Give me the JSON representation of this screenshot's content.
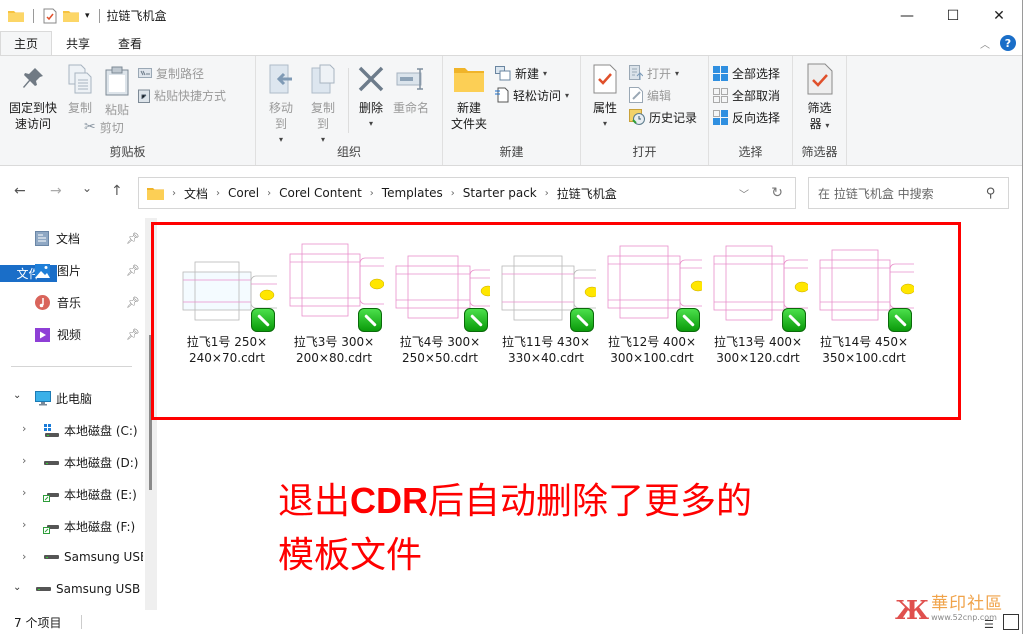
{
  "window": {
    "title": "拉链飞机盒",
    "controls": {
      "minimize": "—",
      "maximize": "☐",
      "close": "✕"
    }
  },
  "ribbon_tabs": [
    {
      "label": "文件"
    },
    {
      "label": "主页"
    },
    {
      "label": "共享"
    },
    {
      "label": "查看"
    }
  ],
  "ribbon": {
    "clipboard": {
      "label": "剪贴板",
      "pin": "固定到快\n速访问",
      "pin_l1": "固定到快",
      "pin_l2": "速访问",
      "copy": "复制",
      "paste": "粘贴",
      "copy_path": "复制路径",
      "paste_shortcut": "粘贴快捷方式",
      "cut": "剪切"
    },
    "organize": {
      "label": "组织",
      "move_to": "移动到",
      "copy_to": "复制到",
      "delete": "删除",
      "rename": "重命名"
    },
    "new": {
      "label": "新建",
      "new_folder_l1": "新建",
      "new_folder_l2": "文件夹",
      "new_item": "新建",
      "easy_access": "轻松访问"
    },
    "open": {
      "label": "打开",
      "properties": "属性",
      "open": "打开",
      "edit": "编辑",
      "history": "历史记录"
    },
    "select": {
      "label": "选择",
      "select_all": "全部选择",
      "select_none": "全部取消",
      "invert": "反向选择"
    },
    "filter": {
      "label": "筛选器",
      "btn_l1": "筛选",
      "btn_l2": "器"
    }
  },
  "nav": {
    "back": "←",
    "forward": "→",
    "recent": "⌄",
    "up": "↑",
    "breadcrumb": [
      "文档",
      "Corel",
      "Corel Content",
      "Templates",
      "Starter pack",
      "拉链飞机盒"
    ],
    "search_placeholder": "在 拉链飞机盒 中搜索"
  },
  "sidebar": {
    "quick": [
      {
        "label": "文档",
        "icon": "documents-icon"
      },
      {
        "label": "图片",
        "icon": "pictures-icon"
      },
      {
        "label": "音乐",
        "icon": "music-icon"
      },
      {
        "label": "视频",
        "icon": "videos-icon"
      }
    ],
    "this_pc": "此电脑",
    "drives": [
      {
        "label": "本地磁盘 (C:)"
      },
      {
        "label": "本地磁盘 (D:)"
      },
      {
        "label": "本地磁盘 (E:)"
      },
      {
        "label": "本地磁盘 (F:)"
      },
      {
        "label": "Samsung USB"
      }
    ],
    "usb": "Samsung USB"
  },
  "files": [
    {
      "line1": "拉飞1号 250×",
      "line2": "240×70.cdrt"
    },
    {
      "line1": "拉飞3号 300×",
      "line2": "200×80.cdrt"
    },
    {
      "line1": "拉飞4号 300×",
      "line2": "250×50.cdrt"
    },
    {
      "line1": "拉飞11号  430×",
      "line2": "330×40.cdrt"
    },
    {
      "line1": "拉飞12号 400×",
      "line2": "300×100.cdrt"
    },
    {
      "line1": "拉飞13号 400×",
      "line2": "300×120.cdrt"
    },
    {
      "line1": "拉飞14号 450×",
      "line2": "350×100.cdrt"
    }
  ],
  "annotation": {
    "pre": "退出",
    "bold": "CDR",
    "post": "后自动删除了更多的",
    "line2": "模板文件",
    "color": "#ff0000"
  },
  "status": {
    "count": "7 个项目"
  },
  "watermark": {
    "name": "華印社區",
    "url": "www.52cnp.com"
  },
  "colors": {
    "file_tab": "#1a6ec8",
    "highlight_box": "#ff0000",
    "ribbon_bg": "#f5f6f7"
  }
}
